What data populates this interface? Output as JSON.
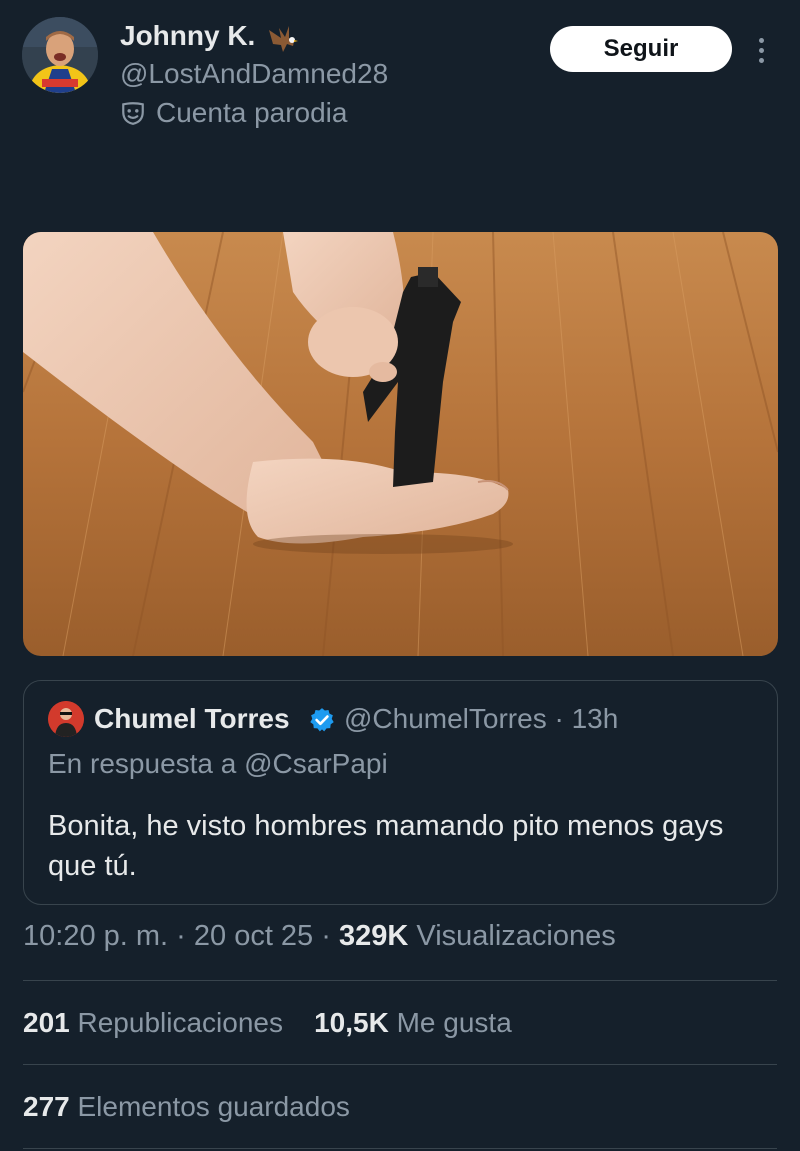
{
  "author": {
    "display_name": "Johnny K.",
    "handle": "@LostAndDamned28",
    "parody_label": "Cuenta parodia",
    "name_emoji": "eagle-emoji"
  },
  "actions": {
    "follow_label": "Seguir",
    "more_icon": "more-vertical-icon"
  },
  "media": {
    "icon": "photo"
  },
  "quoted": {
    "display_name": "Chumel Torres",
    "handle": "@ChumelTorres",
    "time": "13h",
    "reply_to": "En respuesta a @CsarPapi",
    "text": "Bonita, he visto hombres mamando pito menos gays que tú."
  },
  "meta": {
    "time": "10:20 p. m.",
    "date": "20 oct 25",
    "views_count": "329K",
    "views_label": "Visualizaciones"
  },
  "stats": {
    "reposts_count": "201",
    "reposts_label": "Republicaciones",
    "likes_count": "10,5K",
    "likes_label": "Me gusta",
    "bookmarks_count": "277",
    "bookmarks_label": "Elementos guardados"
  },
  "colors": {
    "background": "#15202b",
    "text_primary": "#e7e9ea",
    "text_secondary": "#8b98a5",
    "border": "#38444d",
    "verified": "#1d9bf0"
  }
}
